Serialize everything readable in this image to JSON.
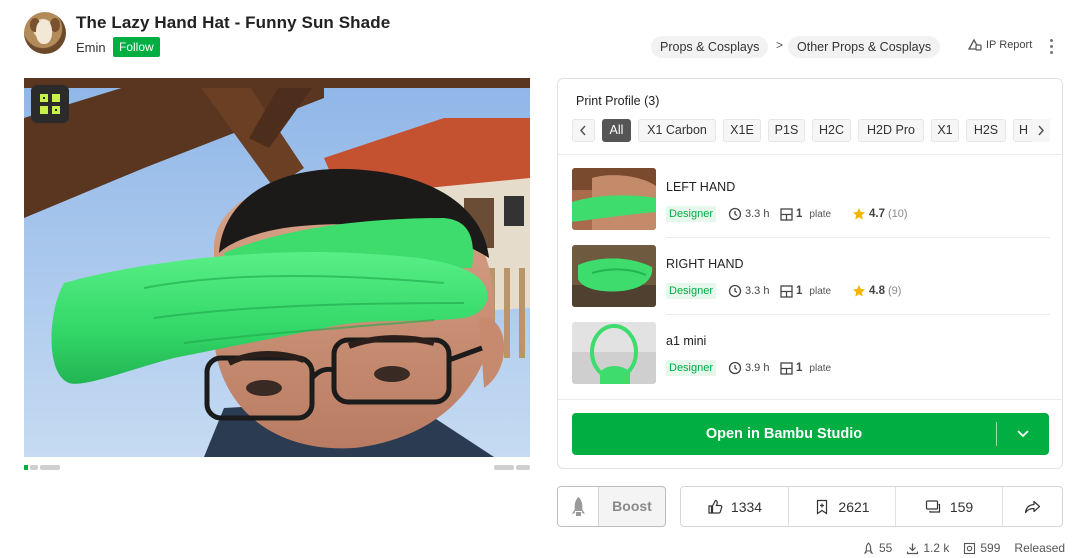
{
  "header": {
    "title": "The Lazy Hand Hat - Funny Sun Shade",
    "author": "Emin",
    "follow_label": "Follow",
    "breadcrumbs": [
      "Props & Cosplays",
      "Other Props & Cosplays"
    ],
    "breadcrumb_separator": ">",
    "ip_report": "IP Report"
  },
  "print_profile": {
    "title": "Print Profile (3)",
    "filters": [
      "All",
      "X1 Carbon",
      "X1E",
      "P1S",
      "H2C",
      "H2D Pro",
      "X1",
      "H2S",
      "H"
    ],
    "active_filter": "All",
    "items": [
      {
        "name": "LEFT HAND",
        "badge": "Designer",
        "time": "3.3 h",
        "plates": "1",
        "plate_label": "plate",
        "rating": "4.7",
        "rating_count": "(10)"
      },
      {
        "name": "RIGHT HAND",
        "badge": "Designer",
        "time": "3.3 h",
        "plates": "1",
        "plate_label": "plate",
        "rating": "4.8",
        "rating_count": "(9)"
      },
      {
        "name": "a1 mini",
        "badge": "Designer",
        "time": "3.9 h",
        "plates": "1",
        "plate_label": "plate"
      }
    ],
    "open_button": "Open in Bambu Studio"
  },
  "actions": {
    "boost_label": "Boost",
    "likes": "1334",
    "collections": "2621",
    "comments": "159"
  },
  "stats": {
    "boosts": "55",
    "downloads": "1.2 k",
    "prints": "599",
    "status": "Released"
  },
  "colors": {
    "brand_green": "#00ae42",
    "model_green": "#3ddc6d"
  },
  "icons": [
    "avatar",
    "bambu-logo-icon",
    "ip-report-icon",
    "more-icon",
    "chevron-left-icon",
    "chevron-right-icon",
    "clock-icon",
    "plate-icon",
    "star-icon",
    "chevron-down-icon",
    "rocket-icon",
    "thumbs-up-icon",
    "bookmark-icon",
    "comments-icon",
    "share-icon",
    "download-icon",
    "print-icon"
  ]
}
